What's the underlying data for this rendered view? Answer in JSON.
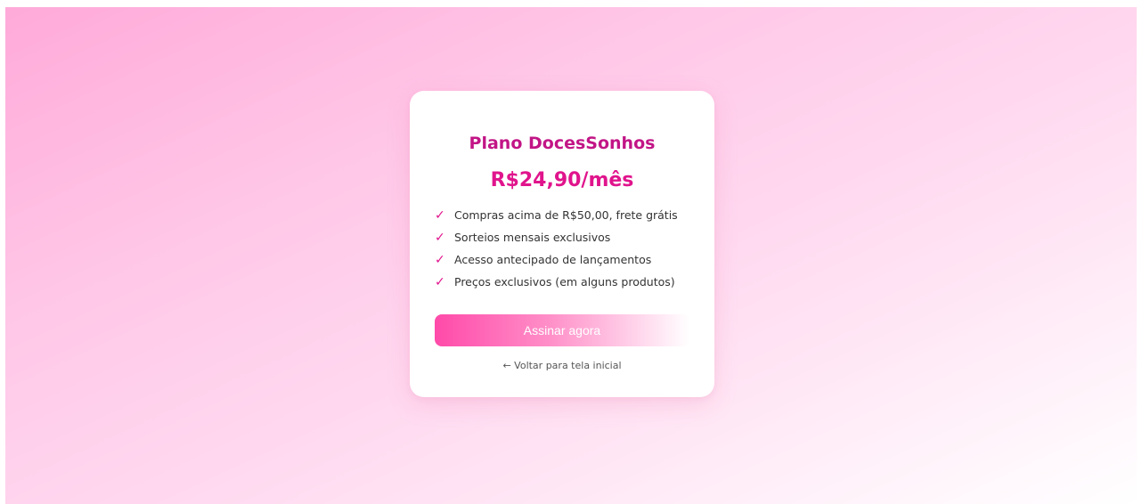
{
  "plan": {
    "title": "Plano DocesSonhos",
    "price": "R$24,90/mês",
    "check_glyph": "✓",
    "features": [
      "Compras acima de R$50,00, frete grátis",
      "Sorteios mensais exclusivos",
      "Acesso antecipado de lançamentos",
      "Preços exclusivos (em alguns produtos)"
    ],
    "subscribe_label": "Assinar agora",
    "back_label": "← Voltar para tela inicial"
  },
  "colors": {
    "accent": "#e0148c",
    "title": "#c21586",
    "button_start": "#ff4aa9",
    "background_start": "#ffaad9",
    "background_end": "#ffffff"
  }
}
